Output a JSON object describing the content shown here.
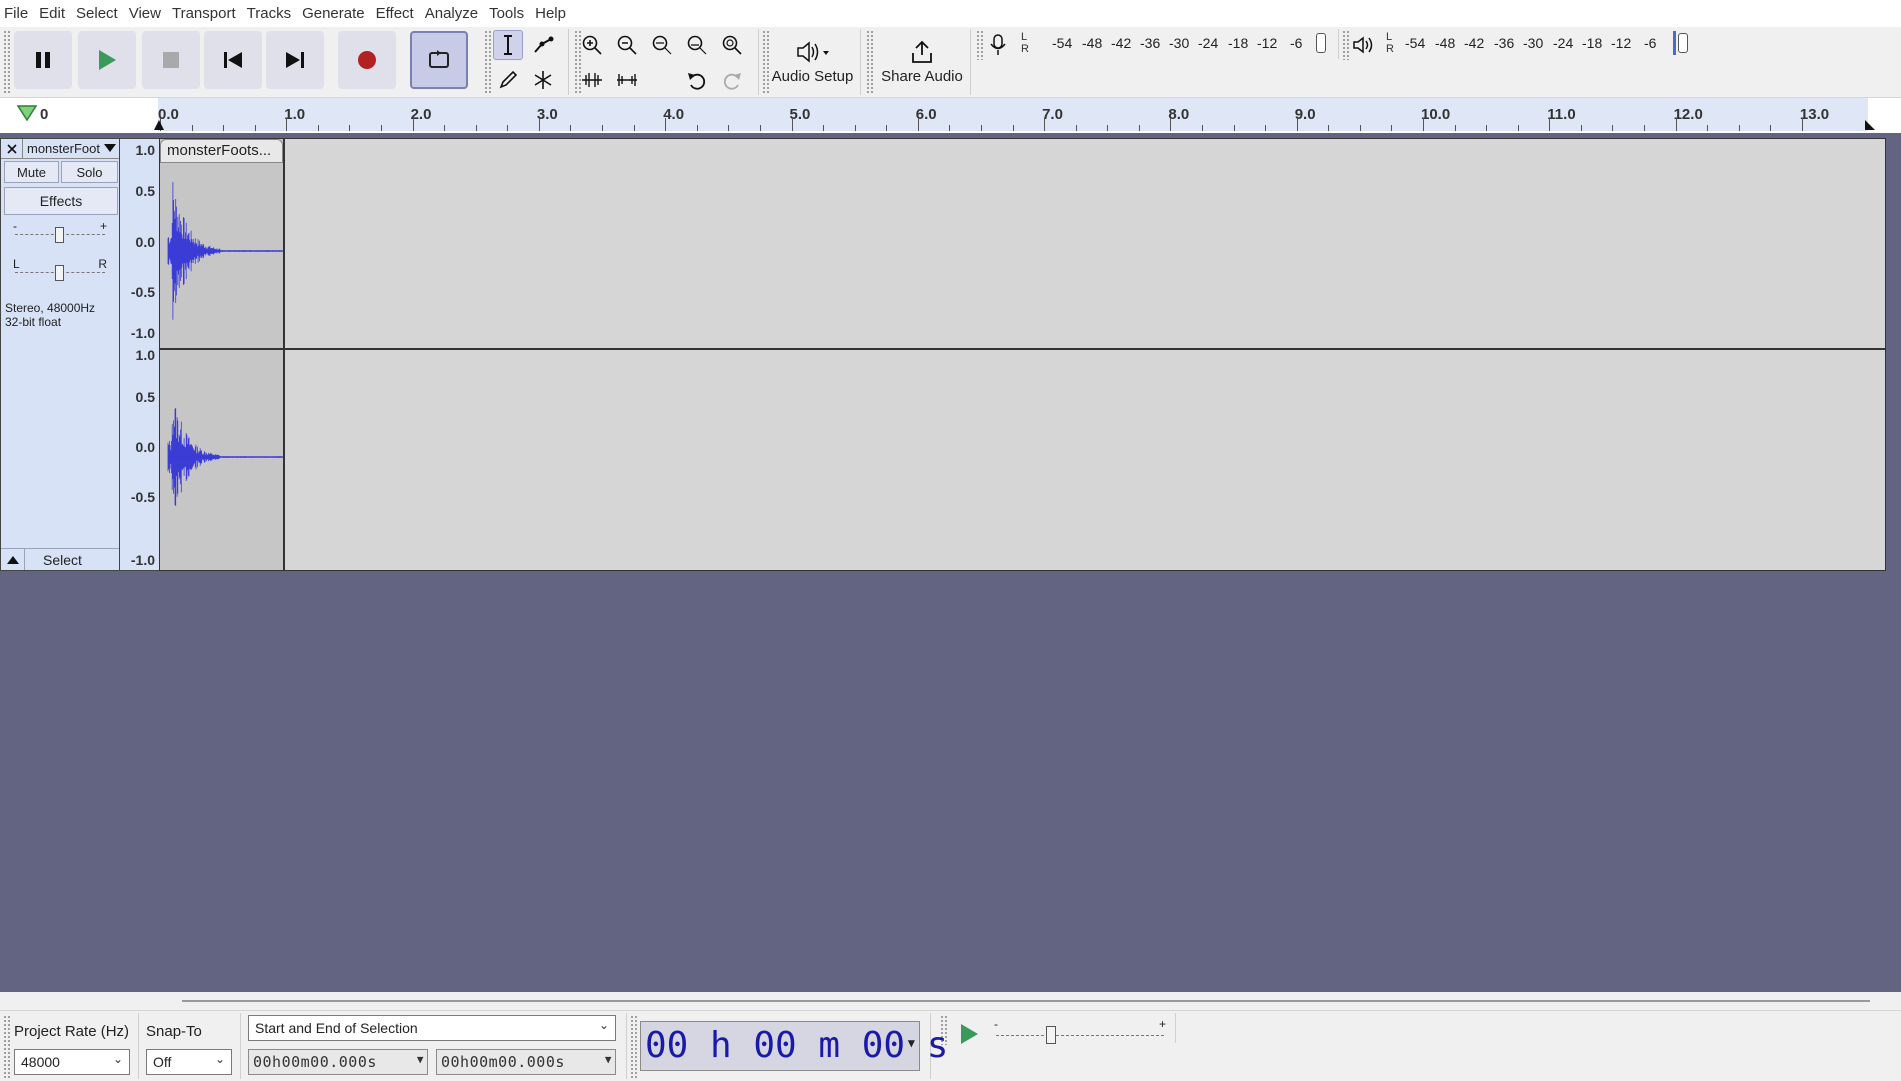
{
  "menu": [
    "File",
    "Edit",
    "Select",
    "View",
    "Transport",
    "Tracks",
    "Generate",
    "Effect",
    "Analyze",
    "Tools",
    "Help"
  ],
  "toolbar": {
    "audio_setup_label": "Audio Setup",
    "share_audio_label": "Share Audio",
    "record_meter_scale": [
      "-54",
      "-48",
      "-42",
      "-36",
      "-30",
      "-24",
      "-18",
      "-12",
      "-6"
    ],
    "play_meter_scale": [
      "-54",
      "-48",
      "-42",
      "-36",
      "-30",
      "-24",
      "-18",
      "-12",
      "-6"
    ],
    "meter_channels": [
      "L",
      "R"
    ]
  },
  "ruler": {
    "start_label": "0",
    "ticks": [
      "0.0",
      "1.0",
      "2.0",
      "3.0",
      "4.0",
      "5.0",
      "6.0",
      "7.0",
      "8.0",
      "9.0",
      "10.0",
      "11.0",
      "12.0",
      "13.0"
    ]
  },
  "track": {
    "name": "monsterFoot",
    "mute_label": "Mute",
    "solo_label": "Solo",
    "effects_label": "Effects",
    "gain_minus": "-",
    "gain_plus": "+",
    "pan_left": "L",
    "pan_right": "R",
    "info_line1": "Stereo, 48000Hz",
    "info_line2": "32-bit float",
    "select_label": "Select",
    "clip_name": "monsterFoots...",
    "amplitude_labels": [
      "1.0",
      "0.5",
      "0.0",
      "-0.5",
      "-1.0"
    ],
    "waveform_color": "#3b3bd6"
  },
  "bottom": {
    "project_rate_label": "Project Rate (Hz)",
    "project_rate_value": "48000",
    "snap_to_label": "Snap-To",
    "snap_to_value": "Off",
    "selection_mode": "Start and End of Selection",
    "selection_start": "00h00m00.000s",
    "selection_end": "00h00m00.000s",
    "big_time": "00 h 00 m 00 s",
    "speed_minus": "-",
    "speed_plus": "+"
  },
  "colors": {
    "play_green": "#3a9a5a",
    "record_red": "#b22222",
    "background": "#626482",
    "track_panel": "#d7e2f7"
  }
}
